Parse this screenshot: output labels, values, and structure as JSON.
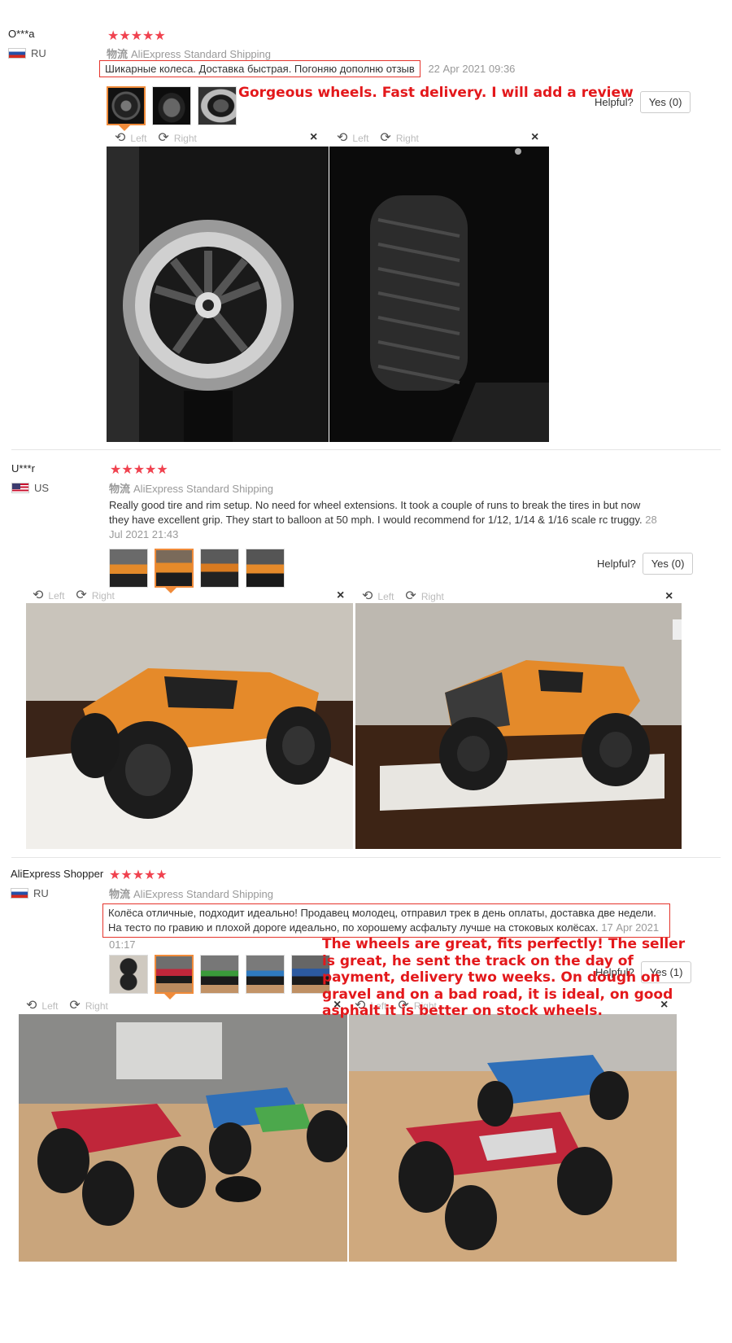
{
  "reviews": [
    {
      "user": "O***a",
      "country": "RU",
      "stars": "★★★★★",
      "shipping_logo": "物流",
      "shipping": "AliExpress Standard Shipping",
      "text": "Шикарные колеса. Доставка быстрая. Погоняю дополню отзыв",
      "date": "22 Apr 2021 09:36",
      "annotation": "Gorgeous wheels. Fast delivery. I will add a review",
      "helpful_label": "Helpful?",
      "yes_label": "Yes (0)",
      "viewer": {
        "left": "Left",
        "right": "Right",
        "close": "×"
      }
    },
    {
      "user": "U***r",
      "country": "US",
      "stars": "★★★★★",
      "shipping_logo": "物流",
      "shipping": "AliExpress Standard Shipping",
      "text_line1": "Really good tire and rim setup. No need for wheel extensions. It took a couple of runs to break the tires in but now",
      "text_line2": "they have excellent grip. They start to balloon at 50 mph. I would recommend for 1/12, 1/14 & 1/16 scale rc truggy.",
      "date_part1": "28",
      "date_part2": "Jul 2021 21:43",
      "helpful_label": "Helpful?",
      "yes_label": "Yes (0)",
      "viewer": {
        "left": "Left",
        "right": "Right",
        "close": "×"
      }
    },
    {
      "user": "AliExpress Shopper",
      "country": "RU",
      "stars": "★★★★★",
      "shipping_logo": "物流",
      "shipping": "AliExpress Standard Shipping",
      "text_line1": "Колёса отличные, подходит идеально! Продавец молодец, отправил трек в день оплаты, доставка две недели.",
      "text_line2": "На тесто по гравию и плохой дороге идеально, по хорошему асфальту лучше на стоковых колёсах.",
      "date_part1": "17 Apr 2021",
      "date_part2": "01:17",
      "annotation": "The wheels are great, fits perfectly! The seller is great, he sent the track on the day of payment, delivery two weeks. On dough on gravel and on a bad road, it is ideal, on good asphalt it is better on stock wheels.",
      "helpful_label": "Helpful?",
      "yes_label": "Yes (1)",
      "viewer": {
        "left": "Left",
        "right": "Right",
        "close": "×"
      }
    }
  ],
  "colors": {
    "star": "#f0424f",
    "annotation": "#e3181b",
    "active_thumb": "#f08b3a"
  }
}
